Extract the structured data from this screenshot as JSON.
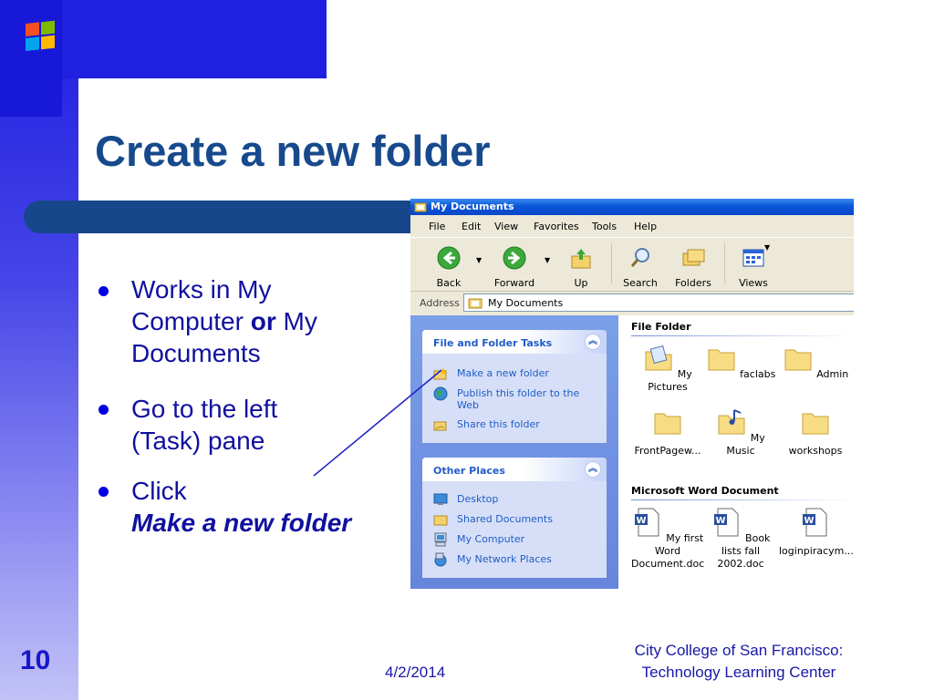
{
  "slide": {
    "title": "Create a new folder",
    "bullets": [
      {
        "lines": [
          "Works in My",
          "Computer ",
          "or",
          " My",
          "Documents"
        ]
      },
      {
        "lines": [
          "Go to the left",
          "(Task) pane"
        ]
      },
      {
        "lines": [
          "Click",
          "Make a new folder"
        ]
      }
    ],
    "number": "10",
    "date": "4/2/2014",
    "footer_line1": "City College of San Francisco:",
    "footer_line2": "Technology Learning Center"
  },
  "window": {
    "title": "My Documents",
    "menu": [
      "File",
      "Edit",
      "View",
      "Favorites",
      "Tools",
      "Help"
    ],
    "toolbar": {
      "back": "Back",
      "forward": "Forward",
      "up": "Up",
      "search": "Search",
      "folders": "Folders",
      "views": "Views"
    },
    "address_label": "Address",
    "address_value": "My Documents",
    "file_tasks": {
      "header": "File and Folder Tasks",
      "items": [
        "Make a new folder",
        "Publish this folder to the Web",
        "Share this folder"
      ]
    },
    "other_places": {
      "header": "Other Places",
      "items": [
        "Desktop",
        "Shared Documents",
        "My Computer",
        "My Network Places"
      ]
    },
    "groups": {
      "folders_header": "File Folder",
      "docs_header": "Microsoft Word Document"
    },
    "folders": [
      "My Pictures",
      "faclabs",
      "Admin",
      "FrontPagew...",
      "My Music",
      "workshops"
    ],
    "documents": [
      {
        "name_line1": "My first Word",
        "name_line2": "Document.doc"
      },
      {
        "name_line1": "Book lists fall",
        "name_line2": "2002.doc"
      },
      {
        "name_line1": "loginpiracym...",
        "name_line2": ""
      }
    ],
    "doc_icon_letter": "W"
  },
  "colors": {
    "slide_title": "#174a8c",
    "accent_blue": "#0000e0",
    "task_link": "#215dc6",
    "xp_title": "#0a56d8"
  }
}
